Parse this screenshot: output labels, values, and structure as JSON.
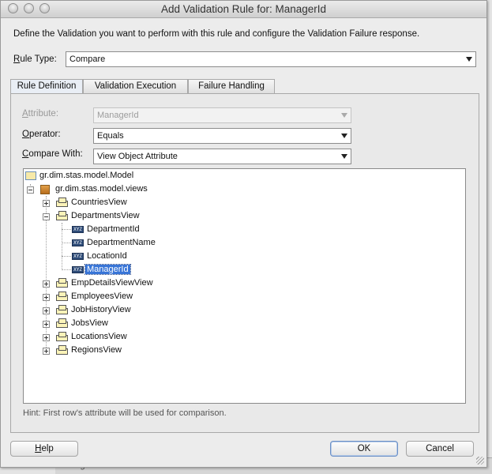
{
  "window": {
    "title": "Add Validation Rule for: ManagerId"
  },
  "intro": "Define the Validation you want to perform with this rule and configure the Validation Failure response.",
  "rule_type": {
    "label_u": "R",
    "label_rest": "ule Type:",
    "value": "Compare"
  },
  "tabs": [
    {
      "label": "Rule Definition"
    },
    {
      "label": "Validation Execution"
    },
    {
      "label": "Failure Handling"
    }
  ],
  "attribute": {
    "label_u": "A",
    "label_rest": "ttribute:",
    "value": "ManagerId"
  },
  "operator": {
    "label_u": "O",
    "label_rest": "perator:",
    "value": "Equals"
  },
  "compare_with": {
    "label_u": "C",
    "label_rest": "ompare With:",
    "value": "View Object Attribute"
  },
  "tree": {
    "root": "gr.dim.stas.model.Model",
    "package": "gr.dim.stas.model.views",
    "views": {
      "countries": "CountriesView",
      "departments": "DepartmentsView",
      "empdetails": "EmpDetailsViewView",
      "employees": "EmployeesView",
      "jobhistory": "JobHistoryView",
      "jobs": "JobsView",
      "locations": "LocationsView",
      "regions": "RegionsView"
    },
    "department_attrs": {
      "department_id": "DepartmentId",
      "department_name": "DepartmentName",
      "location_id": "LocationId",
      "manager_id": "ManagerId"
    },
    "attr_icon_text": "XYZ"
  },
  "hint": "Hint: First row's attribute will be used for comparison.",
  "buttons": {
    "help_u": "H",
    "help_rest": "elp",
    "ok": "OK",
    "cancel": "Cancel"
  },
  "background_text": "ManagerId",
  "icons": [
    "folder-icon",
    "package-icon",
    "view-object-icon",
    "attribute-icon",
    "chevron-down-icon"
  ]
}
